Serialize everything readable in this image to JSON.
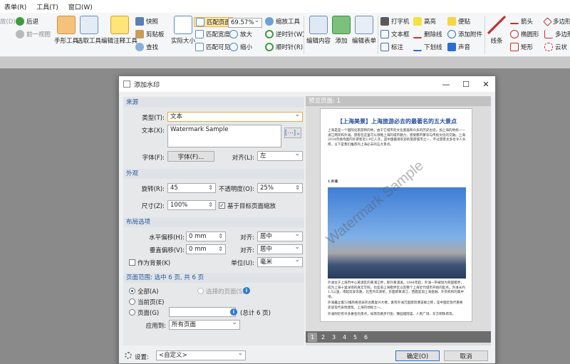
{
  "menu": [
    "表单(R)",
    "工具(T)",
    "窗口(W)"
  ],
  "ribbon": {
    "left": [
      "故(D)",
      "后退",
      "前一视图"
    ],
    "hand_tool": "手形工具",
    "select_tool": "选取工具",
    "annot_tool": "编辑注释工具",
    "snapshot": "快照",
    "clipboard": "剪贴板",
    "find": "查找",
    "actual_size": "实际大小",
    "fit_page": "匹配页面",
    "fit_width": "匹配宽度",
    "fit_visible": "匹配可见",
    "zoom_value": "69.57%",
    "zoom_tool": "缩放工具",
    "zoom_in": "放大",
    "zoom_out": "缩小",
    "rotate_ccw": "逆时针(W)",
    "rotate_cw": "顺时针(R)",
    "edit_content": "编辑内容",
    "add": "添加",
    "edit_form": "编辑表单",
    "typewriter": "打字机",
    "textbox": "文本框",
    "callout": "标注",
    "highlight": "高亮",
    "strikeout": "删除线",
    "underline": "下划线",
    "note": "便贴",
    "attach": "添加附件",
    "sound": "声音",
    "line": "线条",
    "arrow": "箭头",
    "oval": "椭圆形",
    "rect": "矩形",
    "polygon": "多边形",
    "polyline": "多边形",
    "cloud": "云状"
  },
  "dialog": {
    "title": "添加水印",
    "source": {
      "header": "来源",
      "type_label": "类型(T):",
      "type_value": "文本",
      "text_label": "文本(X):",
      "text_value": "Watermark Sample",
      "font_label": "字体(F):",
      "font_btn": "字体(F)...",
      "align_label": "对齐(L):",
      "align_value": "左"
    },
    "appearance": {
      "header": "外观",
      "rotation_label": "旋转(R):",
      "rotation_value": "45",
      "opacity_label": "不透明度(O):",
      "opacity_value": "25%",
      "size_label": "尺寸(Z):",
      "size_value": "100%",
      "scale_label": "基于目标页面缩放"
    },
    "layout": {
      "header": "布局选项",
      "hoffset_label": "水平偏移(H):",
      "hoffset_value": "0 mm",
      "halign_label": "对齐:",
      "halign_value": "居中",
      "voffset_label": "垂直偏移(V):",
      "voffset_value": "0 mm",
      "valign_label": "对齐:",
      "valign_value": "居中",
      "bg_label": "作为背景(K)",
      "unit_label": "单位(U):",
      "unit_value": "毫米"
    },
    "range": {
      "header": "页面范围: 选中 6 页, 共 6 页",
      "all": "全部(A)",
      "selected": "选择的页面(S)",
      "current": "当前页(E)",
      "pages": "页面(G)",
      "total": "(总计 6 页)",
      "apply_label": "应用到:",
      "apply_value": "所有页面"
    },
    "settings_label": "设置:",
    "settings_value": "<自定义>",
    "ok": "确定(O)",
    "cancel": "取消"
  },
  "preview": {
    "header": "预览页面: 1",
    "title": "【上海美景】上海旅游必去的最著名的五大景点",
    "intro": "上海是是一个国际化旅游目的地，由于它城市的文化底蕴和众多的历史古迹，加上海的地标——浦江两岸和外滩。游客在这里可以领略上海的城市魅力，感受都市繁华与传统文化的交融。上海2014年接待国内外游客近2.9亿人次，是中国最受欢迎的旅游城市之一，不过游客太多也令人头疼。以下是我们推荐的上海必去的五大景点。",
    "sub1": "1.外滩",
    "p2": "外滩位于上海市中心黄浦区的黄浦江畔，即外黄浦滩。1844年起，外滩一带被划为英国租界，成为上海十里洋场的真实写照，也是旧上海租界区以及整个上海近代城市开始的起点。外滩长约1.5公里，南起延安东路，北至外白渡桥，东面即黄浦江，西面是旧上海金融、外贸机构的集中地。",
    "p3": "外滩矗立着52幢风格迥异的古典复兴大楼，素有外滩万国建筑博览群之称，是中国近现代重要史迹及代表性建筑，上海的地标之一。",
    "p4": "外滩附近有许多著名的景点，如南京路步行街、豫园城隍庙、人民广场、东方明珠塔等。",
    "watermark": "Watermark Sample",
    "pages": [
      "1",
      "2",
      "3",
      "4",
      "5",
      "6"
    ]
  }
}
